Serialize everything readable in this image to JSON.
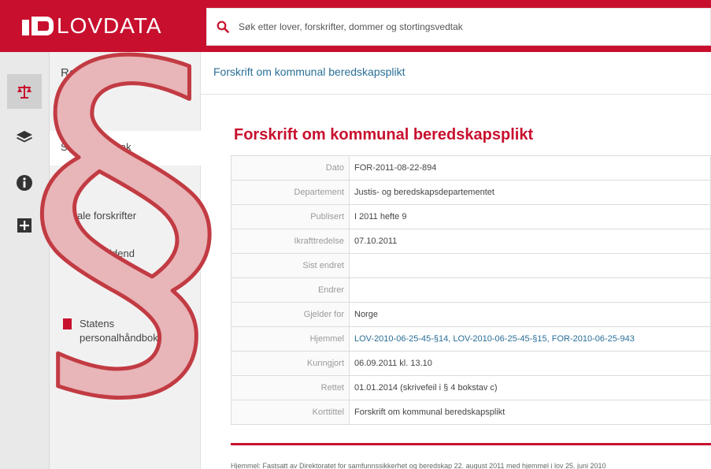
{
  "app": {
    "brand": "LOVDATA"
  },
  "search": {
    "placeholder": "Søk etter lover, forskrifter, dommer og stortingsvedtak"
  },
  "sidebar": {
    "icons": [
      "scales-icon",
      "layers-icon",
      "info-icon",
      "plus-box-icon"
    ],
    "title": "Rettskilder",
    "items": [
      {
        "label": "Stortingsvedtak"
      },
      {
        "label": "Lokale forskrifter"
      },
      {
        "label": "Norsk Lovtidend"
      },
      {
        "label": "Statens personalhåndbok"
      }
    ]
  },
  "breadcrumb": {
    "label": "Forskrift om kommunal beredskapsplikt"
  },
  "document": {
    "title": "Forskrift om kommunal beredskapsplikt",
    "meta": [
      {
        "key": "Dato",
        "value": "FOR-2011-08-22-894"
      },
      {
        "key": "Departement",
        "value": "Justis- og beredskapsdepartementet"
      },
      {
        "key": "Publisert",
        "value": "I 2011 hefte 9"
      },
      {
        "key": "Ikrafttredelse",
        "value": "07.10.2011"
      },
      {
        "key": "Sist endret",
        "value": ""
      },
      {
        "key": "Endrer",
        "value": ""
      },
      {
        "key": "Gjelder for",
        "value": "Norge"
      },
      {
        "key": "Hjemmel",
        "value": "LOV-2010-06-25-45-§14, LOV-2010-06-25-45-§15, FOR-2010-06-25-943"
      },
      {
        "key": "Kunngjort",
        "value": "06.09.2011   kl. 13.10"
      },
      {
        "key": "Rettet",
        "value": "01.01.2014 (skrivefeil i § 4 bokstav c)"
      },
      {
        "key": "Korttittel",
        "value": "Forskrift om kommunal beredskapsplikt"
      }
    ],
    "footer_note": "Hjemmel: Fastsatt av Direktoratet for samfunnssikkerhet og beredskap 22. august 2011 med hjemmel i lov 25. juni 2010"
  },
  "overlay": {
    "symbol": "§",
    "fill": "#e8b5b8",
    "stroke": "#c23b43"
  },
  "colors": {
    "brand": "#c8102e",
    "link": "#2a6f97"
  }
}
